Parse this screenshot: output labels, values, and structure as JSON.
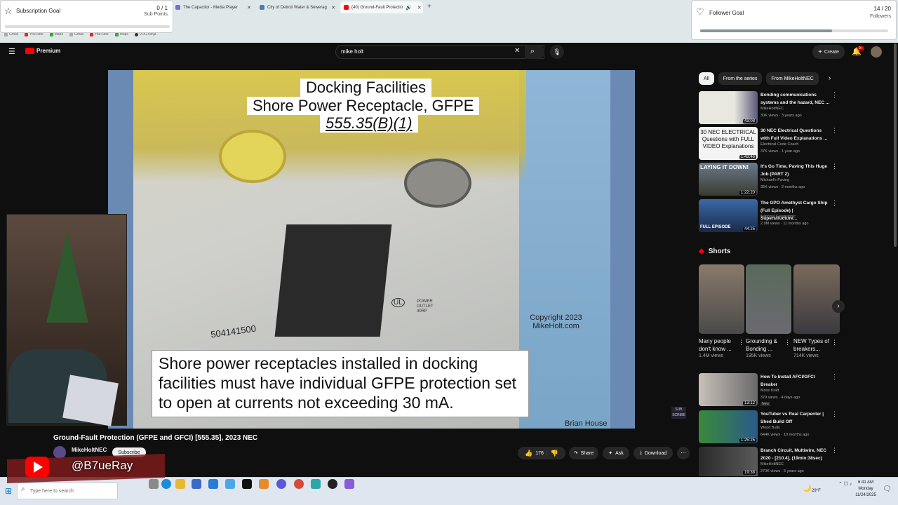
{
  "browser": {
    "tabs": [
      {
        "label": "The Capacitor - Media Player",
        "active": false
      },
      {
        "label": "City of Detroit Water & Sewerag",
        "active": false
      },
      {
        "label": "(40) Ground-Fault Protectio",
        "active": true
      }
    ],
    "new_tab": "+",
    "bookmarks": [
      "Gmail",
      "YouTube",
      "Maps",
      "Gmail",
      "YouTube",
      "Maps",
      "VDO.Ninja"
    ]
  },
  "subscription_goal": {
    "title": "Subscription Goal",
    "value": "0 / 1",
    "unit": "Sub Points",
    "progress": 0.0
  },
  "follower_goal": {
    "title": "Follower Goal",
    "value": "14 / 20",
    "unit": "Followers",
    "progress": 0.7
  },
  "youtube": {
    "logo_text": "Premium",
    "search_value": "mike holt",
    "create_label": "Create",
    "notification_count": "9+"
  },
  "video": {
    "slide_heading_1": "Docking Facilities",
    "slide_heading_2": "Shore Power Receptacle, GFPE",
    "slide_heading_3": "555.35(B)(1)",
    "slide_body": "Shore power receptacles installed in docking facilities must have individual GFPE protection set to open at currents not exceeding 30 mA.",
    "copyright_1": "Copyright 2023",
    "copyright_2": "MikeHolt.com",
    "presenter": "Brian House",
    "part_number": "504141500",
    "outlet_label_1": "POWER",
    "outlet_label_2": "OUTLET",
    "outlet_label_3": "40RP",
    "breaker_label": "UL",
    "title": "Ground-Fault Protection (GFPE and GFCI) [555.35], 2023 NEC",
    "channel": "MikeHoltNEC",
    "subscribe_label": "Subscribe",
    "likes": "176",
    "share_label": "Share",
    "ask_label": "Ask",
    "download_label": "Download"
  },
  "chips": [
    "All",
    "From the series",
    "From MikeHoltNEC"
  ],
  "recommendations": [
    {
      "title": "Bonding communications systems and the hazard, NEC ...",
      "channel": "MikeHoltNEC",
      "meta": "30K views · 3 years ago",
      "duration": "43:08"
    },
    {
      "title": "30 NEC Electrical Questions with Full Video Explanations ...",
      "channel": "Electrical Code Coach",
      "meta": "37K views · 1 year ago",
      "duration": "1:43:46"
    },
    {
      "title": "It's Go Time, Paving This Huge Job (PART 2)",
      "channel": "Michael's Paving",
      "meta": "35K views · 2 months ago",
      "duration": "1:22:20"
    },
    {
      "title": "The GPO Amethyst Cargo Ship (Full Episode) | Superstructure...",
      "channel": "National Geographic",
      "meta": "2.9M views · 11 months ago",
      "duration": "44:25"
    }
  ],
  "thumb_texts": {
    "t2": "30 NEC ELECTRICAL Questions with FULL VIDEO Explanations",
    "t3": "LAYING IT DOWN!",
    "t4": "FULL EPISODE"
  },
  "shorts_heading": "Shorts",
  "shorts": [
    {
      "title": "Many people don't know ...",
      "views": "1.4M views"
    },
    {
      "title": "Grounding & Bonding ...",
      "views": "195K views"
    },
    {
      "title": "NEW Types of breakers...",
      "views": "714K views"
    }
  ],
  "recommendations_2": [
    {
      "title": "How To Install AFCI/GFCI Breaker",
      "channel": "Moss Kraft",
      "meta": "379 views · 4 days ago",
      "badge": "New",
      "duration": "13:12"
    },
    {
      "title": "YouTuber vs Real Carpenter | Shed Build Off",
      "channel": "Wood Bully",
      "meta": "644K views · 10 months ago",
      "duration": "1:25:25"
    },
    {
      "title": "Branch Circuit, Multiwire, NEC 2020 - [210.4], (19min:38sec)",
      "channel": "MikeHoltNEC",
      "meta": "270K views · 5 years ago",
      "duration": "19:38"
    }
  ],
  "stream_overlay": {
    "handle": "@B7ueRay",
    "sub_badge": "SUB SCRIBE"
  },
  "taskbar": {
    "search_placeholder": "Type here to search",
    "temperature": "29°F",
    "time": "6:41 AM",
    "day": "Monday",
    "date": "11/24/2025"
  },
  "colors": {
    "youtube_red": "#ff0000",
    "accent_blue": "#3ea6ff"
  }
}
